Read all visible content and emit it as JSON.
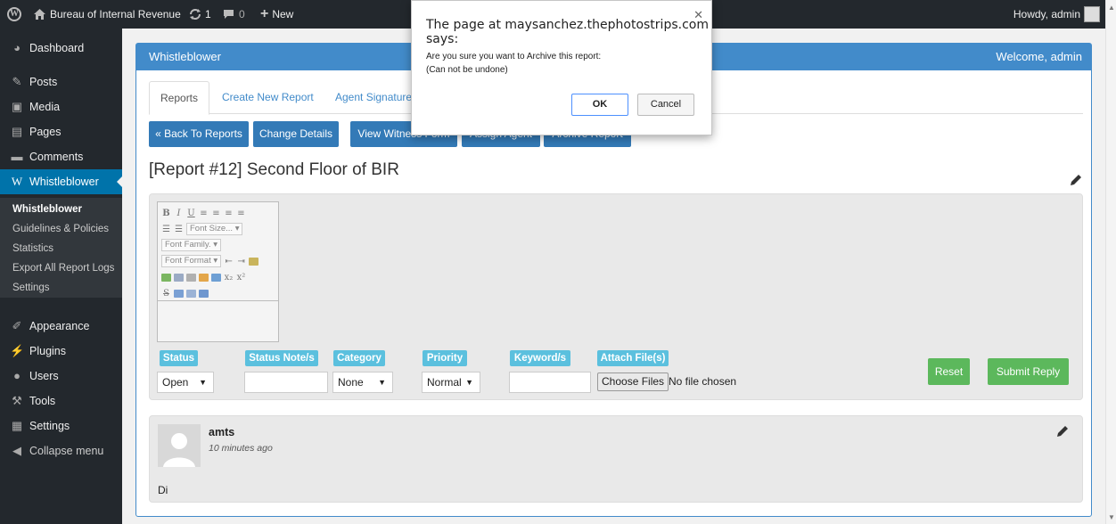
{
  "adminbar": {
    "site_name": "Bureau of Internal Revenue",
    "updates_count": "1",
    "comments_count": "0",
    "new_label": "New",
    "howdy": "Howdy, admin"
  },
  "sidebar": {
    "items": [
      {
        "label": "Dashboard",
        "icon": "dashboard-icon"
      },
      {
        "label": "Posts",
        "icon": "pin-icon"
      },
      {
        "label": "Media",
        "icon": "media-icon"
      },
      {
        "label": "Pages",
        "icon": "pages-icon"
      },
      {
        "label": "Comments",
        "icon": "comments-icon"
      },
      {
        "label": "Whistleblower",
        "icon": "wordpress-icon"
      }
    ],
    "submenu": [
      "Whistleblower",
      "Guidelines & Policies",
      "Statistics",
      "Export All Report Logs",
      "Settings"
    ],
    "lower_items": [
      {
        "label": "Appearance",
        "icon": "brush-icon"
      },
      {
        "label": "Plugins",
        "icon": "plugin-icon"
      },
      {
        "label": "Users",
        "icon": "users-icon"
      },
      {
        "label": "Tools",
        "icon": "wrench-icon"
      },
      {
        "label": "Settings",
        "icon": "settings-icon"
      },
      {
        "label": "Collapse menu",
        "icon": "collapse-icon"
      }
    ]
  },
  "panel": {
    "title": "Whistleblower",
    "welcome": "Welcome, admin"
  },
  "tabs": [
    "Reports",
    "Create New Report",
    "Agent Signature"
  ],
  "actions": {
    "back": "« Back To Reports",
    "change_details": "Change Details",
    "view_witness": "View Witness Form",
    "assign_agent": "Assign Agent",
    "archive": "Archive Report"
  },
  "report": {
    "title": "[Report #12] Second Floor of BIR"
  },
  "editor": {
    "font_size": "Font Size...",
    "font_family": "Font Family.",
    "font_format": "Font Format"
  },
  "form": {
    "status_label": "Status",
    "status_value": "Open",
    "status_note_label": "Status Note/s",
    "status_note_value": "",
    "category_label": "Category",
    "category_value": "None",
    "priority_label": "Priority",
    "priority_value": "Normal",
    "keywords_label": "Keyword/s",
    "keywords_value": "",
    "attach_label": "Attach File(s)",
    "choose_files": "Choose Files",
    "no_file": "No file chosen",
    "reset": "Reset",
    "submit": "Submit Reply"
  },
  "comment": {
    "author": "amts",
    "time": "10 minutes ago",
    "body": "Di"
  },
  "dialog": {
    "title": "The page at maysanchez.thephotostrips.com says:",
    "line1": "Are you sure you want to Archive this report:",
    "line2": "(Can not be undone)",
    "ok": "OK",
    "cancel": "Cancel"
  },
  "colors": {
    "admin_bg": "#23282d",
    "accent": "#0073aa",
    "panel_blue": "#428bca",
    "button_blue": "#337ab7",
    "label_cyan": "#5bc0de",
    "button_green": "#5cb85c"
  }
}
